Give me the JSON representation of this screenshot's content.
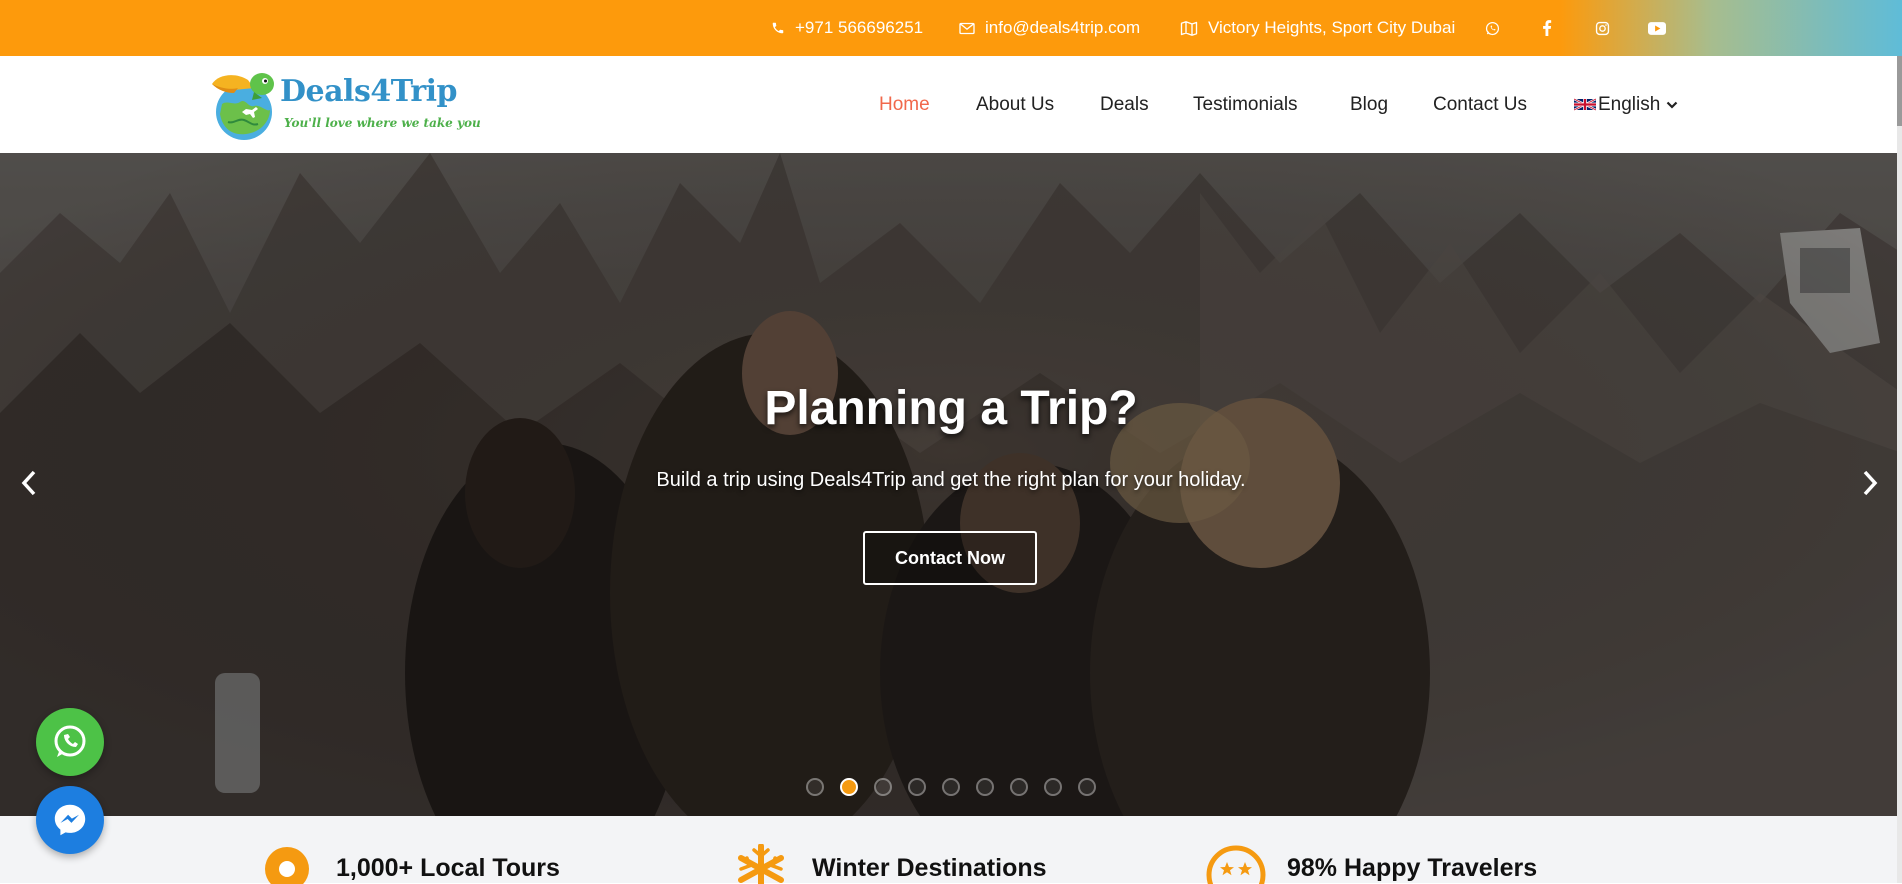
{
  "topbar": {
    "phone": "+971 566696251",
    "email": "info@deals4trip.com",
    "address": "Victory Heights, Sport City Dubai",
    "social": [
      "whatsapp-icon",
      "facebook-icon",
      "instagram-icon",
      "youtube-icon"
    ]
  },
  "logo": {
    "name": "Deals4Trip",
    "tagline": "You'll love where we take you"
  },
  "nav": {
    "items": [
      {
        "label": "Home",
        "active": true
      },
      {
        "label": "About Us"
      },
      {
        "label": "Deals"
      },
      {
        "label": "Testimonials"
      },
      {
        "label": "Blog"
      },
      {
        "label": "Contact Us"
      }
    ],
    "language": "English"
  },
  "hero": {
    "title": "Planning a Trip?",
    "subtitle": "Build a trip using Deals4Trip and get the right plan for your holiday.",
    "button": "Contact Now",
    "slide_count": 9,
    "active_slide": 2
  },
  "features": [
    {
      "label": "1,000+ Local Tours",
      "icon": "location-pin-icon"
    },
    {
      "label": "Winter Destinations",
      "icon": "snowflake-icon"
    },
    {
      "label": "98% Happy Travelers",
      "icon": "rating-stars-icon"
    }
  ],
  "colors": {
    "topbar": "#fd9a0c",
    "accent": "#f1684b",
    "active_dot": "#f59a11",
    "whatsapp": "#4dc247",
    "messenger": "#1d7ee0"
  }
}
